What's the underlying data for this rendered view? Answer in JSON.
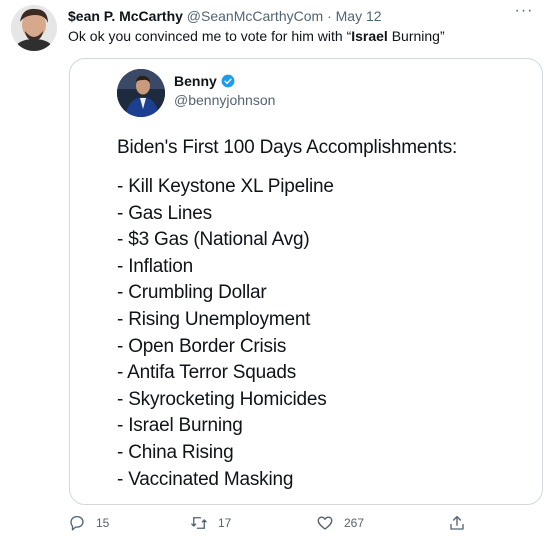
{
  "tweet": {
    "author_name": "$ean P. McCarthy",
    "author_handle": "@SeanMcCarthyCom",
    "separator": "·",
    "date": "May 12",
    "more_label": "···",
    "text_prefix": "Ok ok you convinced me to vote for him with “",
    "text_bold": "Israel",
    "text_suffix": " Burning”"
  },
  "quoted": {
    "author_name": "Benny",
    "author_handle": "@bennyjohnson",
    "title": "Biden's First 100 Days Accomplishments:",
    "items": [
      "- Kill Keystone XL Pipeline",
      "- Gas Lines",
      "- $3 Gas (National Avg)",
      "- Inflation",
      "- Crumbling Dollar",
      "- Rising Unemployment",
      "- Open Border Crisis",
      "- Antifa Terror Squads",
      "- Skyrocketing Homicides",
      "- Israel Burning",
      "- China Rising",
      "- Vaccinated Masking"
    ]
  },
  "actions": {
    "replies": "15",
    "retweets": "17",
    "likes": "267"
  },
  "colors": {
    "text": "#0f1419",
    "secondary": "#536471",
    "border": "#cfd9de",
    "verified": "#1d9bf0"
  }
}
